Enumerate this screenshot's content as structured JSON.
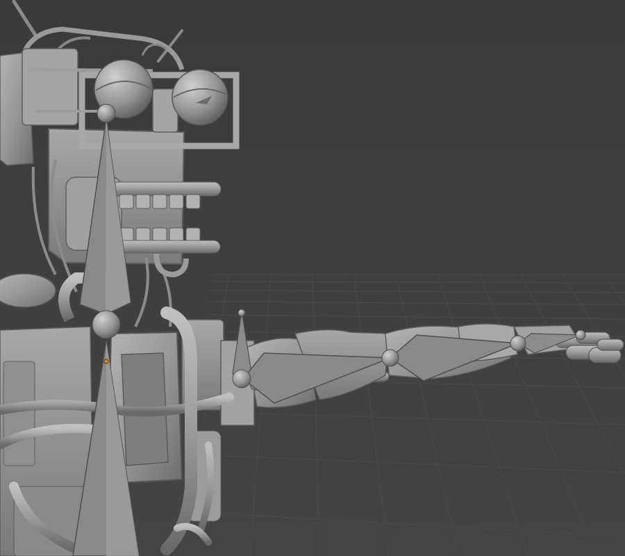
{
  "viewport": {
    "background_color": "#3d3d3d",
    "grid_line_color": "#4a4a4a",
    "model_color": "#9a9a9a",
    "bone_color": "#8e8e8e",
    "selected_origin_color": "#e08a1e"
  }
}
